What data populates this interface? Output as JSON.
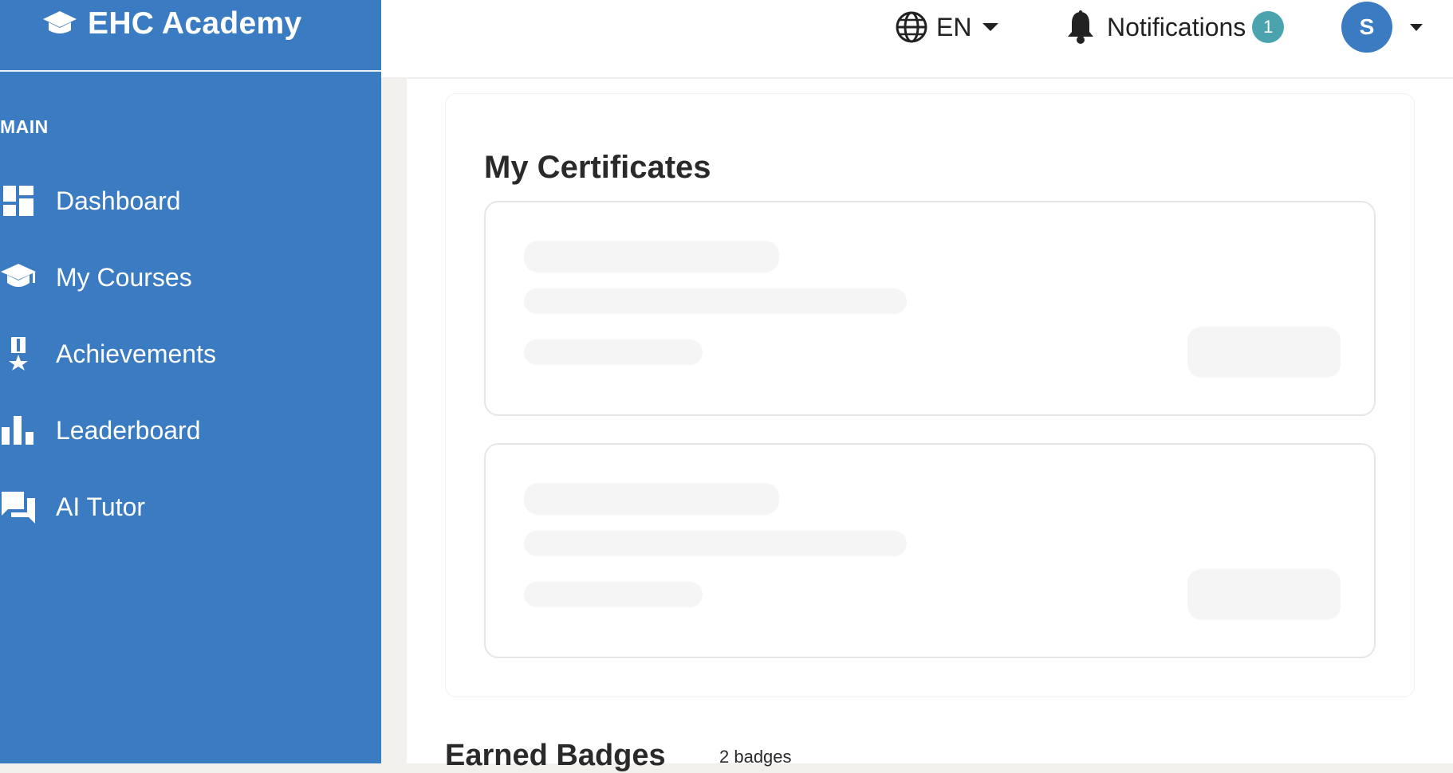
{
  "brand": {
    "name": "EHC Academy",
    "logo_icon": "graduation-cap-icon"
  },
  "sidebar": {
    "section_label": "MAIN",
    "items": [
      {
        "label": "Dashboard",
        "icon": "dashboard-icon"
      },
      {
        "label": "My Courses",
        "icon": "graduation-cap-icon"
      },
      {
        "label": "Achievements",
        "icon": "medal-icon"
      },
      {
        "label": "Leaderboard",
        "icon": "bar-chart-icon"
      },
      {
        "label": "AI Tutor",
        "icon": "chat-icon"
      }
    ],
    "color": "#3a7bc2"
  },
  "topbar": {
    "language": {
      "label": "EN",
      "icon": "globe-icon"
    },
    "notifications": {
      "label": "Notifications",
      "count": "1",
      "icon": "bell-icon",
      "badge_color": "#4aa3ad"
    },
    "user": {
      "initial": "S"
    }
  },
  "main": {
    "certificates_title": "My Certificates",
    "badges_title": "Earned Badges",
    "badges_count": "2 badges"
  }
}
